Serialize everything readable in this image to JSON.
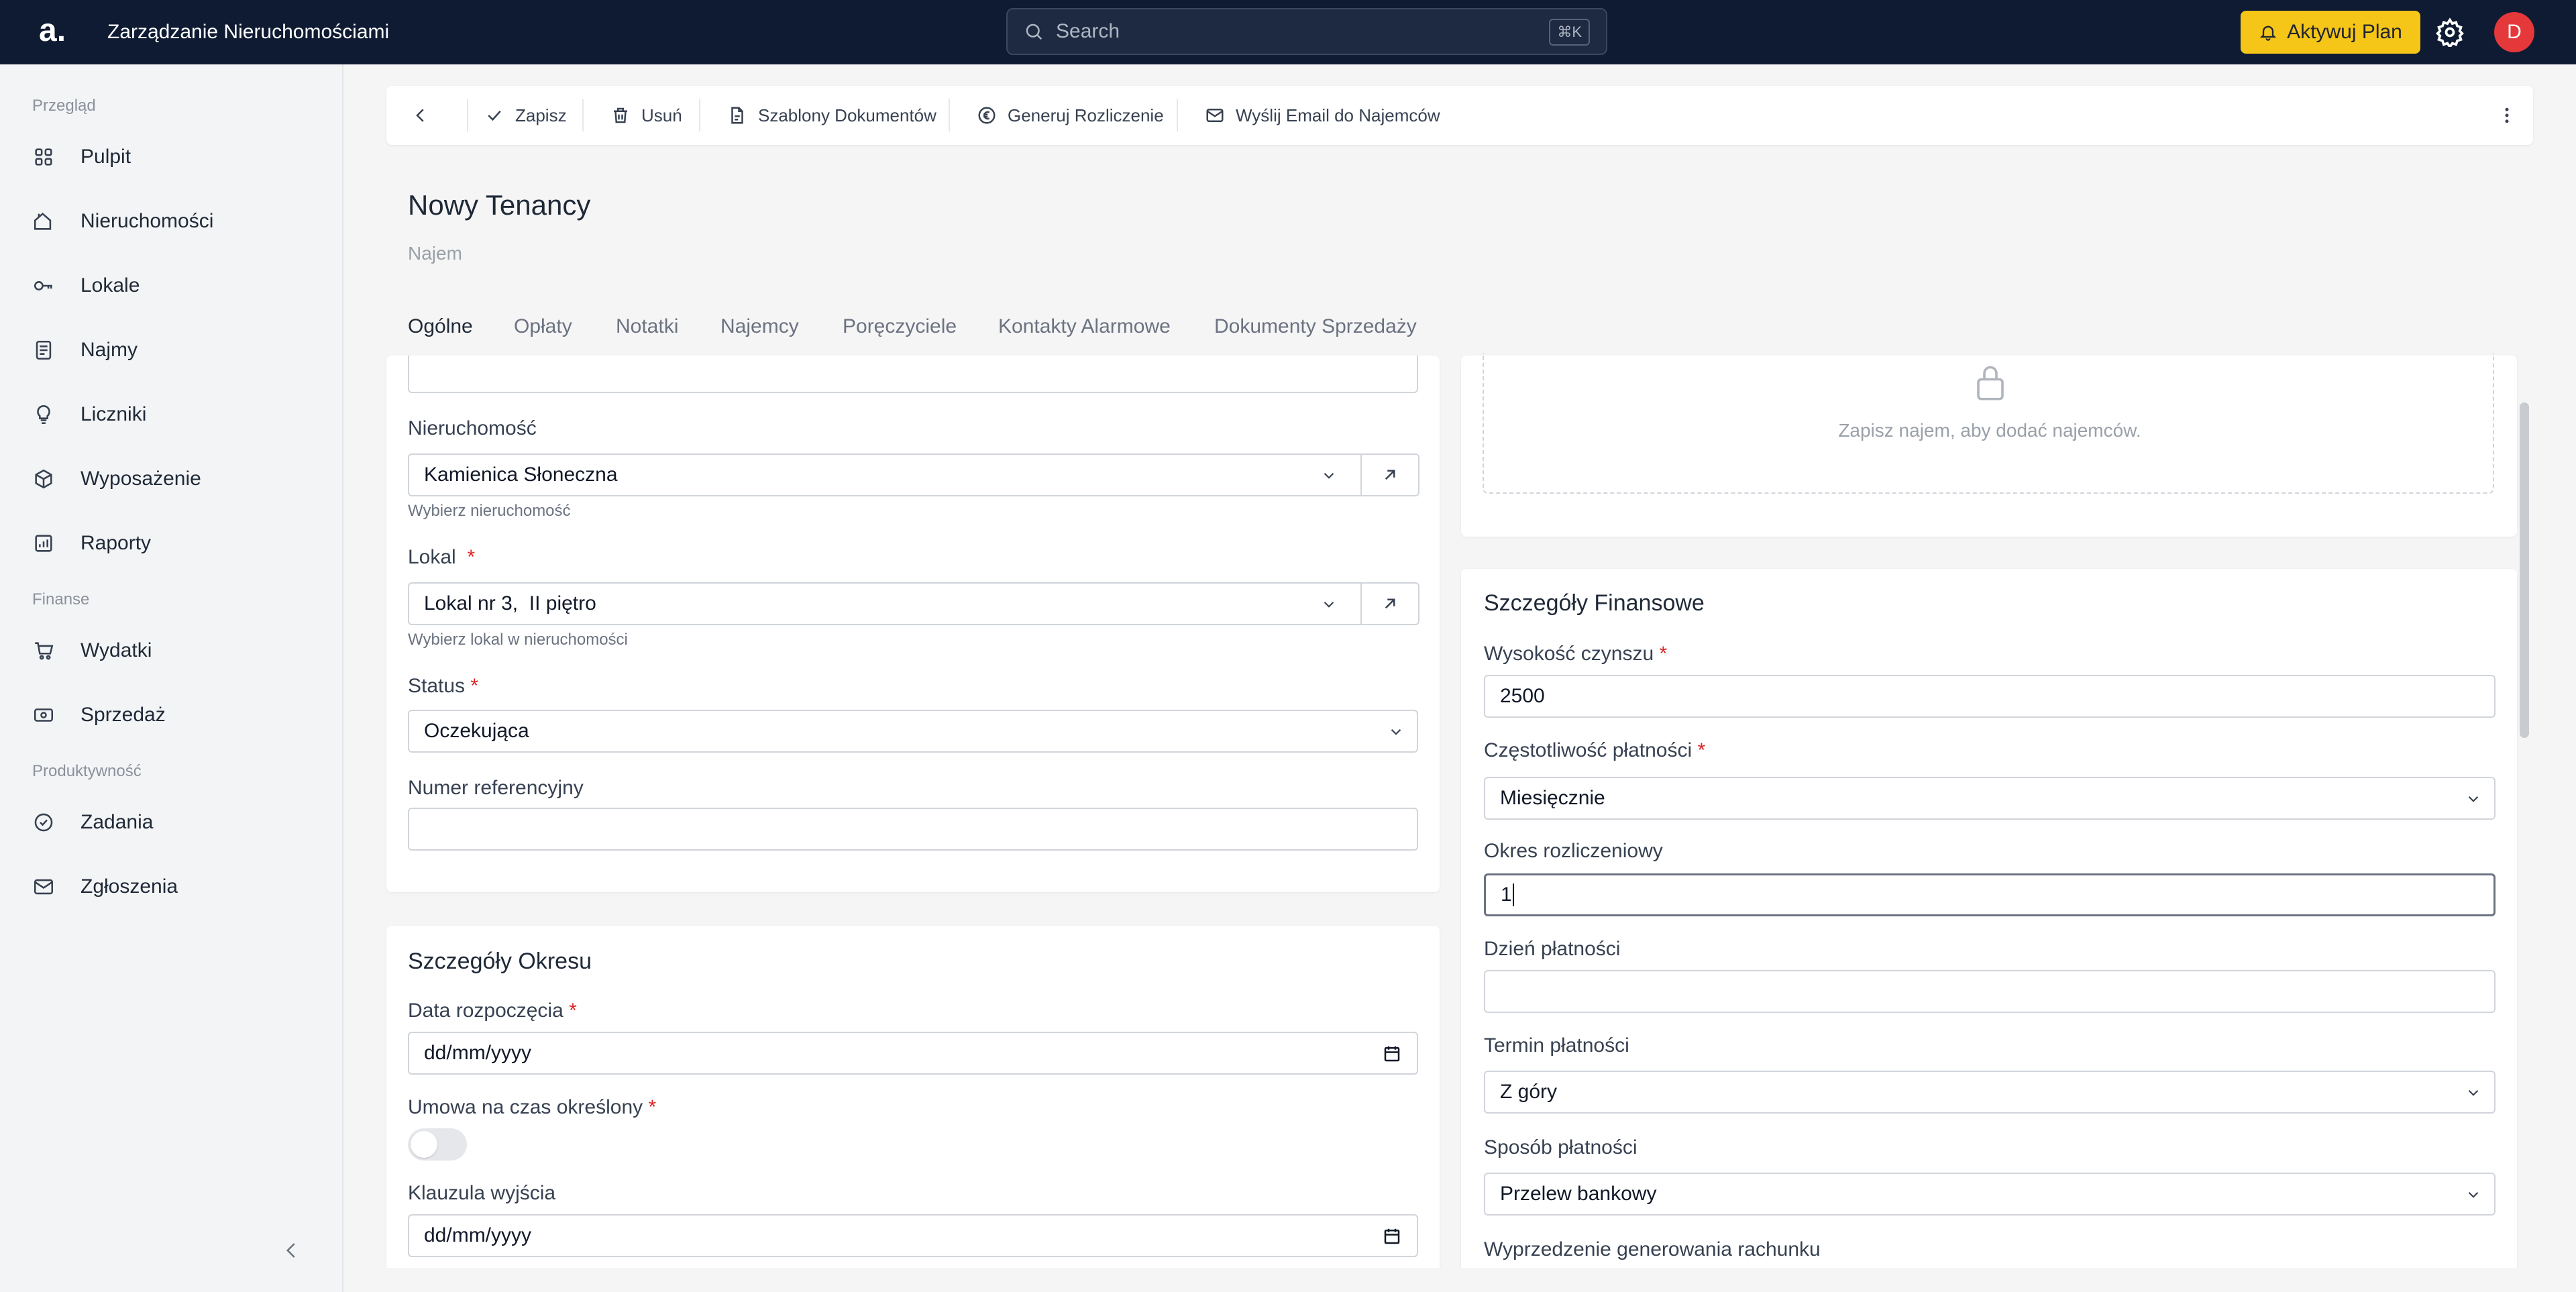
{
  "app": {
    "logo": "a.",
    "title": "Zarządzanie Nieruchomościami",
    "search_placeholder": "Search",
    "search_shortcut": "⌘K",
    "plan_button": "Aktywuj Plan",
    "avatar_initial": "D"
  },
  "sidebar": {
    "sections": [
      {
        "label": "Przegląd"
      },
      {
        "label": "Finanse"
      },
      {
        "label": "Produktywność"
      }
    ],
    "items": [
      {
        "label": "Pulpit",
        "icon": "dashboard-icon"
      },
      {
        "label": "Nieruchomości",
        "icon": "building-icon"
      },
      {
        "label": "Lokale",
        "icon": "key-icon"
      },
      {
        "label": "Najmy",
        "icon": "document-icon"
      },
      {
        "label": "Liczniki",
        "icon": "lightbulb-icon"
      },
      {
        "label": "Wyposażenie",
        "icon": "box-icon"
      },
      {
        "label": "Raporty",
        "icon": "report-icon"
      },
      {
        "label": "Wydatki",
        "icon": "cart-icon"
      },
      {
        "label": "Sprzedaż",
        "icon": "money-icon"
      },
      {
        "label": "Zadania",
        "icon": "check-circle-icon"
      },
      {
        "label": "Zgłoszenia",
        "icon": "mail-icon"
      }
    ]
  },
  "toolbar": {
    "save": "Zapisz",
    "delete": "Usuń",
    "templates": "Szablony Dokumentów",
    "settlement": "Generuj Rozliczenie",
    "email": "Wyślij Email do Najemców"
  },
  "page": {
    "title": "Nowy Tenancy",
    "subtitle": "Najem"
  },
  "tabs": [
    "Ogólne",
    "Opłaty",
    "Notatki",
    "Najemcy",
    "Poręczyciele",
    "Kontakty Alarmowe",
    "Dokumenty Sprzedaży"
  ],
  "general": {
    "property_label": "Nieruchomość",
    "property_value": "Kamienica Słoneczna",
    "property_help": "Wybierz nieruchomość",
    "unit_label": "Lokal",
    "unit_value": "Lokal nr 3,  II piętro",
    "unit_help": "Wybierz lokal w nieruchomości",
    "status_label": "Status",
    "status_value": "Oczekująca",
    "ref_label": "Numer referencyjny",
    "ref_value": ""
  },
  "period": {
    "title": "Szczegóły Okresu",
    "start_label": "Data rozpoczęcia",
    "start_placeholder": "dd/mm/yyyy",
    "fixed_label": "Umowa na czas określony",
    "fixed_on": false,
    "exit_label": "Klauzula wyjścia",
    "exit_placeholder": "dd/mm/yyyy"
  },
  "tenants_notice": {
    "text": "Zapisz najem, aby dodać najemców."
  },
  "finance": {
    "title": "Szczegóły Finansowe",
    "rent_label": "Wysokość czynszu",
    "rent_value": "2500",
    "freq_label": "Częstotliwość płatności",
    "freq_value": "Miesięcznie",
    "period_label": "Okres rozliczeniowy",
    "period_value": "1",
    "day_label": "Dzień płatności",
    "day_value": "",
    "term_label": "Termin płatności",
    "term_value": "Z góry",
    "method_label": "Sposób płatności",
    "method_value": "Przelew bankowy",
    "advance_label": "Wyprzedzenie generowania rachunku"
  },
  "colors": {
    "topbar": "#0f1b33",
    "accent": "#f5c518",
    "avatar": "#e5383b",
    "required": "#dc2626"
  }
}
